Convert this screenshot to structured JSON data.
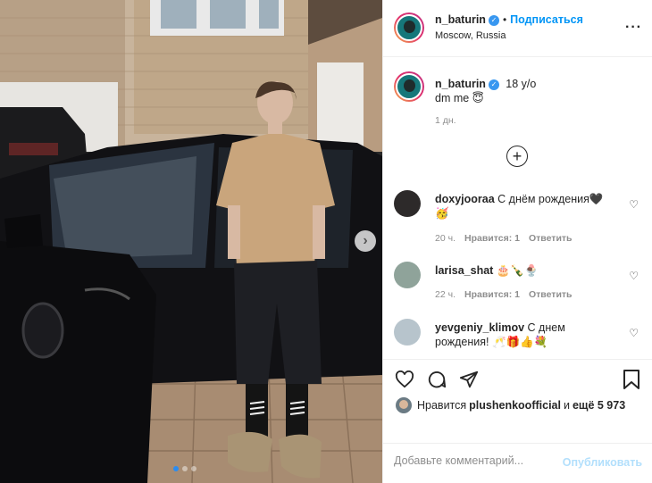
{
  "header": {
    "username": "n_baturin",
    "follow_label": "Подписаться",
    "location": "Moscow, Russia"
  },
  "caption": {
    "username": "n_baturin",
    "line1": "18 y/o",
    "line2": "dm me 😇",
    "time": "1 дн."
  },
  "comments": [
    {
      "username": "doxyjooraa",
      "text": "С днём рождения🖤",
      "text2": "🥳",
      "time": "20 ч.",
      "likes": "Нравится: 1",
      "reply": "Ответить"
    },
    {
      "username": "larisa_shat",
      "text": "🎂🍾🍨",
      "time": "22 ч.",
      "likes": "Нравится: 1",
      "reply": "Ответить"
    },
    {
      "username": "yevgeniy_klimov",
      "text": "С днем",
      "text2": "рождения! 🥂🎁👍💐"
    }
  ],
  "likes": {
    "prefix": "Нравится",
    "user": "plushenkoofficial",
    "middle": "и",
    "count": "ещё 5 973"
  },
  "add_comment": {
    "placeholder": "Добавьте комментарий...",
    "publish_label": "Опубликовать"
  },
  "carousel": {
    "slides": 3,
    "active_index": 0
  },
  "colors": {
    "accent": "#0095f6",
    "publish_disabled": "#b2dffc",
    "muted": "#8e8e8e",
    "text": "#262626"
  },
  "icons": [
    "more-icon",
    "verified-icon",
    "add-circle-icon",
    "heart-icon",
    "comment-icon",
    "share-icon",
    "bookmark-icon",
    "next-arrow-icon"
  ]
}
